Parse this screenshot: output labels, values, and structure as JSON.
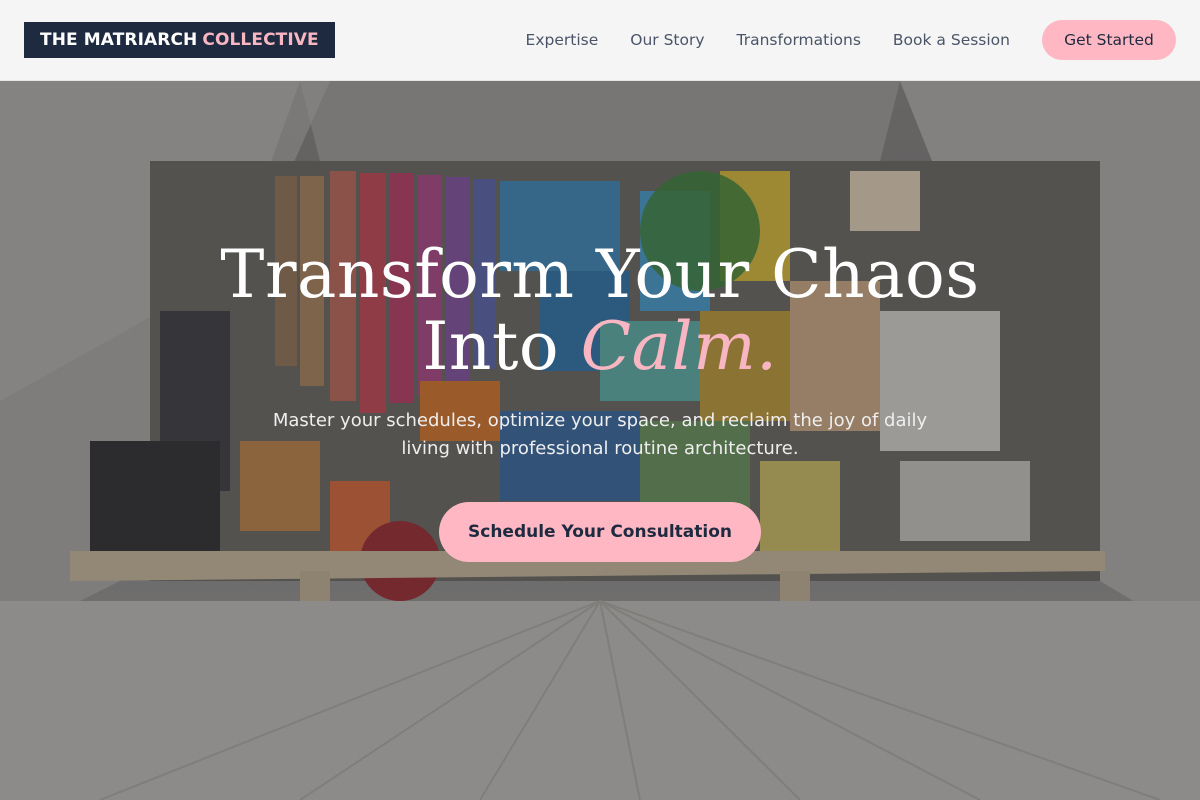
{
  "brand": {
    "name_main": "THE MATRIARCH",
    "name_accent": "COLLECTIVE"
  },
  "nav": {
    "items": [
      {
        "label": "Expertise"
      },
      {
        "label": "Our Story"
      },
      {
        "label": "Transformations"
      },
      {
        "label": "Book a Session"
      }
    ],
    "cta_label": "Get Started"
  },
  "hero": {
    "headline_line1": "Transform Your Chaos",
    "headline_line2_prefix": "Into",
    "headline_line2_accent": "Calm.",
    "subheadline": "Master your schedules, optimize your space, and reclaim the joy of daily living with professional routine architecture.",
    "cta_label": "Schedule Your Consultation"
  },
  "colors": {
    "navy": "#1e2a3f",
    "pink": "#ffb8c3",
    "pink_text": "#f7b6c2",
    "header_bg": "#f5f5f5"
  }
}
